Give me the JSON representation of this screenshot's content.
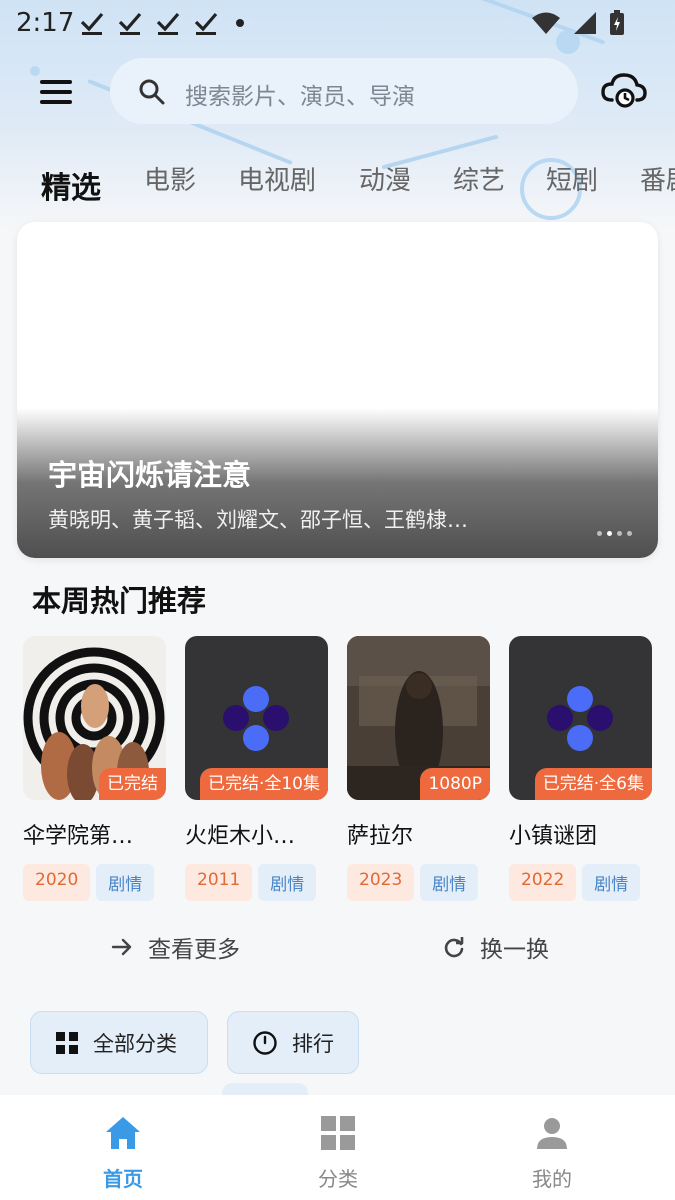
{
  "status_bar": {
    "time": "2:17",
    "notification_icons": [
      "check-icon",
      "check-icon",
      "check-icon",
      "check-icon",
      "dot-icon"
    ],
    "system_icons": [
      "wifi-icon",
      "signal-icon",
      "battery-charging-icon"
    ]
  },
  "search": {
    "placeholder": "搜索影片、演员、导演"
  },
  "tabs": [
    {
      "label": "精选",
      "active": true
    },
    {
      "label": "电影"
    },
    {
      "label": "电视剧"
    },
    {
      "label": "动漫"
    },
    {
      "label": "综艺"
    },
    {
      "label": "短剧"
    },
    {
      "label": "番剧"
    }
  ],
  "banner": {
    "title": "宇宙闪烁请注意",
    "subtitle": "黄晓明、黄子韬、刘耀文、邵子恒、王鹤棣…"
  },
  "section": {
    "title": "本周热门推荐"
  },
  "cards": [
    {
      "title": "伞学院第…",
      "badge": "已完结",
      "year": "2020",
      "genre": "剧情"
    },
    {
      "title": "火炬木小…",
      "badge": "已完结·全10集",
      "year": "2011",
      "genre": "剧情"
    },
    {
      "title": "萨拉尔",
      "badge": "1080P",
      "year": "2023",
      "genre": "剧情"
    },
    {
      "title": "小镇谜团",
      "badge": "已完结·全6集",
      "year": "2022",
      "genre": "剧情"
    }
  ],
  "actions": {
    "more": "查看更多",
    "refresh": "换一换"
  },
  "quick_links": {
    "all_categories": "全部分类",
    "ranking": "排行"
  },
  "bottom_nav": [
    {
      "label": "首页",
      "active": true
    },
    {
      "label": "分类"
    },
    {
      "label": "我的"
    }
  ],
  "colors": {
    "accent": "#3b9ae6",
    "badge": "#ee6a3e",
    "year_tag": "#e06a36",
    "genre_tag": "#4a85c7"
  }
}
